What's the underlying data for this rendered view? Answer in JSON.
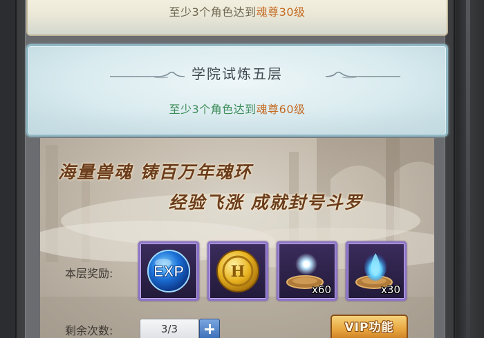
{
  "floors": {
    "previous": {
      "requirement_prefix": "至少3个角色达到",
      "requirement_highlight": "魂尊30级"
    },
    "current": {
      "title": "学院试炼五层",
      "requirement_prefix": "至少3个角色达到",
      "requirement_highlight": "魂尊60级"
    }
  },
  "banner": {
    "line1": "海量兽魂  铸百万年魂环",
    "line2": "经验飞涨  成就封号斗罗"
  },
  "rewards": {
    "label": "本层奖励:",
    "items": [
      {
        "icon": "exp-orb-icon",
        "count": ""
      },
      {
        "icon": "gold-coin-icon",
        "count": ""
      },
      {
        "icon": "soul-spirit-icon",
        "count": "x60"
      },
      {
        "icon": "blue-flame-icon",
        "count": "x30"
      }
    ]
  },
  "remaining": {
    "label": "剩余次数:",
    "value": "3/3"
  },
  "vip_button": {
    "label": "VIP功能"
  },
  "colors": {
    "highlight": "#c46a22",
    "requirement_green": "#3c8c58",
    "slot_border": "#8e74c7"
  }
}
